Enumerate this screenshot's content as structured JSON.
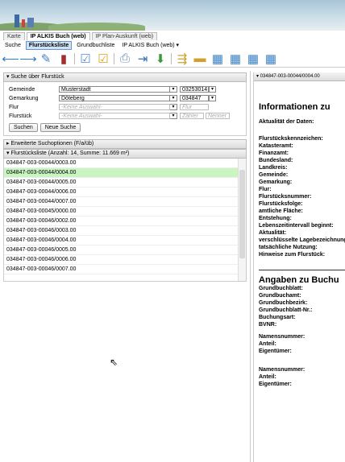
{
  "tabs_top": [
    {
      "label": "Karte",
      "active": false
    },
    {
      "label": "IP ALKIS Buch (web)",
      "active": true
    },
    {
      "label": "IP Plan-Auskunft (web)",
      "active": false
    }
  ],
  "tabs_second": [
    {
      "label": "Suche",
      "active": false
    },
    {
      "label": "Flurstücksliste",
      "active": true
    },
    {
      "label": "Grundbuchliste",
      "active": false
    },
    {
      "label": "IP ALKIS Buch (web) ▾",
      "active": false
    }
  ],
  "search_panel": {
    "title": "▾ Suche über Flurstück",
    "fields": [
      {
        "label": "Gemeinde",
        "value": "Musterstadt",
        "code": "03253014"
      },
      {
        "label": "Gemarkung",
        "value": "Döteberg",
        "code": "034847"
      },
      {
        "label": "Flur",
        "placeholder": "-Keine Auswahl-",
        "code_placeholder": "Flur"
      },
      {
        "label": "Flurstück",
        "placeholder": "-Keine Auswahl-",
        "zaehler": "Zähler",
        "nenner": "Nenner"
      }
    ],
    "buttons": {
      "search": "Suchen",
      "new_search": "Neue Suche"
    }
  },
  "extended_options": "▸ Erweiterte Suchoptionen  (F/a/üb)",
  "list_panel": {
    "title": "▾ Flurstücksliste (Anzahl: 14, Summe: 11.669 m²)",
    "rows": [
      "034847-003-00044/0003.00",
      "034847-003-00044/0004.00",
      "034847-003-00044/0005.00",
      "034847-003-00044/0006.00",
      "034847-003-00044/0007.00",
      "034847-003-00045/0000.00",
      "034847-003-00046/0002.00",
      "034847-003-00046/0003.00",
      "034847-003-00046/0004.00",
      "034847-003-00046/0005.00",
      "034847-003-00046/0006.00",
      "034847-003-00046/0007.00"
    ],
    "selected_index": 1
  },
  "right_panel": {
    "tab": "▾ 034847-003-00044/0004.00",
    "heading1": "Informationen zu",
    "aktualitaet": "Aktualität der Daten:",
    "labels1": [
      "Flurstückskennzeichen:",
      "Katasteramt:",
      "Finanzamt:",
      "Bundesland:",
      "Landkreis:",
      "Gemeinde:",
      "Gemarkung:",
      "Flur:",
      "Flurstücksnummer:",
      "Flurstücksfolge:",
      "amtliche Fläche:",
      "Entstehung:",
      "Lebenszeitintervall beginnt:",
      "Aktualität:",
      "verschlüsselte Lagebezeichnung:",
      "tatsächliche Nutzung:",
      "Hinweise zum Flurstück:"
    ],
    "heading2": "Angaben zu Buchu",
    "labels2": [
      "Grundbuchblatt:",
      "Grundbuchamt:",
      "Grundbuchbezirk:",
      "Grundbuchblatt-Nr.:",
      "Buchungsart:",
      "BVNR:"
    ],
    "labels3": [
      "Namensnummer:",
      "Anteil:",
      "Eigentümer:"
    ],
    "labels4": [
      "Namensnummer:",
      "Anteil:",
      "Eigentümer:"
    ]
  },
  "toolbar_icons": [
    "back-arrow-icon",
    "forward-arrow-icon",
    "edit-doc-icon",
    "book-info-icon",
    "doc-check-icon",
    "doc-check-orange-icon",
    "print-icon",
    "save-icon",
    "download-icon",
    "export-icon",
    "bookmark-icon",
    "grid-icon",
    "table-export-icon",
    "table-add-icon",
    "table-view-icon"
  ]
}
